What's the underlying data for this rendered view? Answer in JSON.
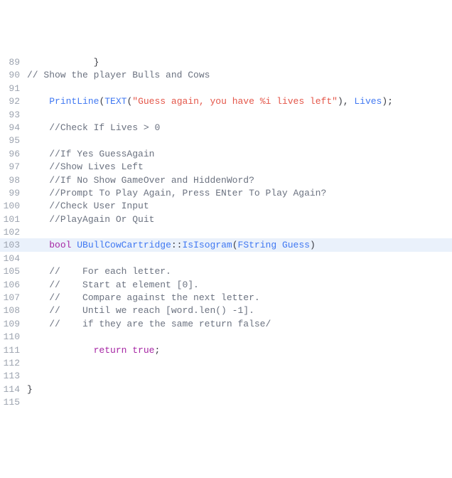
{
  "editor": {
    "highlighted_line": 103,
    "lines": [
      {
        "num": 89,
        "indent": "            ",
        "tokens": [
          {
            "cls": "tok-punct",
            "t": "}"
          }
        ]
      },
      {
        "num": 90,
        "indent": "",
        "tokens": [
          {
            "cls": "tok-comment",
            "t": "// Show the player Bulls and Cows"
          }
        ]
      },
      {
        "num": 91,
        "indent": "",
        "tokens": []
      },
      {
        "num": 92,
        "indent": "    ",
        "tokens": [
          {
            "cls": "tok-func",
            "t": "PrintLine"
          },
          {
            "cls": "tok-punct",
            "t": "("
          },
          {
            "cls": "tok-macro",
            "t": "TEXT"
          },
          {
            "cls": "tok-punct",
            "t": "("
          },
          {
            "cls": "tok-string",
            "t": "\"Guess again, you have %i lives left\""
          },
          {
            "cls": "tok-punct",
            "t": "), "
          },
          {
            "cls": "tok-ident",
            "t": "Lives"
          },
          {
            "cls": "tok-punct",
            "t": ");"
          }
        ]
      },
      {
        "num": 93,
        "indent": "",
        "tokens": []
      },
      {
        "num": 94,
        "indent": "    ",
        "tokens": [
          {
            "cls": "tok-comment",
            "t": "//Check If Lives > 0"
          }
        ]
      },
      {
        "num": 95,
        "indent": "",
        "tokens": []
      },
      {
        "num": 96,
        "indent": "    ",
        "tokens": [
          {
            "cls": "tok-comment",
            "t": "//If Yes GuessAgain"
          }
        ]
      },
      {
        "num": 97,
        "indent": "    ",
        "tokens": [
          {
            "cls": "tok-comment",
            "t": "//Show Lives Left"
          }
        ]
      },
      {
        "num": 98,
        "indent": "    ",
        "tokens": [
          {
            "cls": "tok-comment",
            "t": "//If No Show GameOver and HiddenWord?"
          }
        ]
      },
      {
        "num": 99,
        "indent": "    ",
        "tokens": [
          {
            "cls": "tok-comment",
            "t": "//Prompt To Play Again, Press ENter To Play Again?"
          }
        ]
      },
      {
        "num": 100,
        "indent": "    ",
        "tokens": [
          {
            "cls": "tok-comment",
            "t": "//Check User Input"
          }
        ]
      },
      {
        "num": 101,
        "indent": "    ",
        "tokens": [
          {
            "cls": "tok-comment",
            "t": "//PlayAgain Or Quit"
          }
        ]
      },
      {
        "num": 102,
        "indent": "",
        "tokens": []
      },
      {
        "num": 103,
        "indent": "    ",
        "tokens": [
          {
            "cls": "tok-keyword",
            "t": "bool"
          },
          {
            "cls": "tok-plain",
            "t": " "
          },
          {
            "cls": "tok-type",
            "t": "UBullCowCartridge"
          },
          {
            "cls": "tok-punct",
            "t": "::"
          },
          {
            "cls": "tok-func",
            "t": "IsIsogram"
          },
          {
            "cls": "tok-punct",
            "t": "("
          },
          {
            "cls": "tok-type",
            "t": "FString"
          },
          {
            "cls": "tok-plain",
            "t": " "
          },
          {
            "cls": "tok-ident",
            "t": "Guess"
          },
          {
            "cls": "tok-punct",
            "t": ")"
          }
        ]
      },
      {
        "num": 104,
        "indent": "",
        "tokens": []
      },
      {
        "num": 105,
        "indent": "    ",
        "tokens": [
          {
            "cls": "tok-comment",
            "t": "//    For each letter."
          }
        ]
      },
      {
        "num": 106,
        "indent": "    ",
        "tokens": [
          {
            "cls": "tok-comment",
            "t": "//    Start at element [0]."
          }
        ]
      },
      {
        "num": 107,
        "indent": "    ",
        "tokens": [
          {
            "cls": "tok-comment",
            "t": "//    Compare against the next letter."
          }
        ]
      },
      {
        "num": 108,
        "indent": "    ",
        "tokens": [
          {
            "cls": "tok-comment",
            "t": "//    Until we reach [word.len() -1]."
          }
        ]
      },
      {
        "num": 109,
        "indent": "    ",
        "tokens": [
          {
            "cls": "tok-comment",
            "t": "//    if they are the same return false/"
          }
        ]
      },
      {
        "num": 110,
        "indent": "",
        "tokens": []
      },
      {
        "num": 111,
        "indent": "            ",
        "tokens": [
          {
            "cls": "tok-keyword",
            "t": "return"
          },
          {
            "cls": "tok-plain",
            "t": " "
          },
          {
            "cls": "tok-keyword",
            "t": "true"
          },
          {
            "cls": "tok-punct",
            "t": ";"
          }
        ]
      },
      {
        "num": 112,
        "indent": "",
        "tokens": []
      },
      {
        "num": 113,
        "indent": "",
        "tokens": []
      },
      {
        "num": 114,
        "indent": "",
        "tokens": [
          {
            "cls": "tok-punct",
            "t": "}"
          }
        ]
      },
      {
        "num": 115,
        "indent": "",
        "tokens": []
      }
    ]
  }
}
